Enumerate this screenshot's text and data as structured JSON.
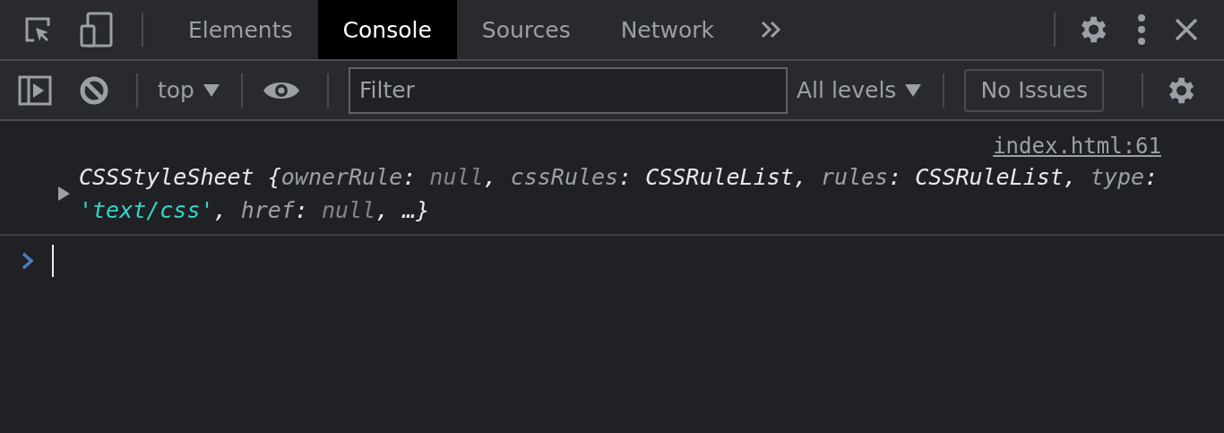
{
  "tabs": [
    {
      "label": "Elements",
      "selected": false
    },
    {
      "label": "Console",
      "selected": true
    },
    {
      "label": "Sources",
      "selected": false
    },
    {
      "label": "Network",
      "selected": false
    }
  ],
  "console_toolbar": {
    "context": "top",
    "filter": {
      "placeholder": "Filter"
    },
    "levels": "All levels",
    "issues": "No Issues"
  },
  "messages": [
    {
      "source": "index.html:61",
      "expanded": false,
      "tokens": [
        {
          "kind": "name",
          "text": "CSSStyleSheet"
        },
        {
          "kind": "punct",
          "text": " {"
        },
        {
          "kind": "key",
          "text": "ownerRule"
        },
        {
          "kind": "punct",
          "text": ": "
        },
        {
          "kind": "null",
          "text": "null"
        },
        {
          "kind": "punct",
          "text": ", "
        },
        {
          "kind": "key",
          "text": "cssRules"
        },
        {
          "kind": "punct",
          "text": ": "
        },
        {
          "kind": "name",
          "text": "CSSRuleList"
        },
        {
          "kind": "punct",
          "text": ", "
        },
        {
          "kind": "key",
          "text": "rules"
        },
        {
          "kind": "punct",
          "text": ": "
        },
        {
          "kind": "name",
          "text": "CSSRuleList"
        },
        {
          "kind": "punct",
          "text": ", "
        },
        {
          "kind": "key",
          "text": "type"
        },
        {
          "kind": "punct",
          "text": ": "
        },
        {
          "kind": "string",
          "text": "'text/css'"
        },
        {
          "kind": "punct",
          "text": ", "
        },
        {
          "kind": "key",
          "text": "href"
        },
        {
          "kind": "punct",
          "text": ": "
        },
        {
          "kind": "null",
          "text": "null"
        },
        {
          "kind": "punct",
          "text": ", …}"
        }
      ]
    }
  ]
}
